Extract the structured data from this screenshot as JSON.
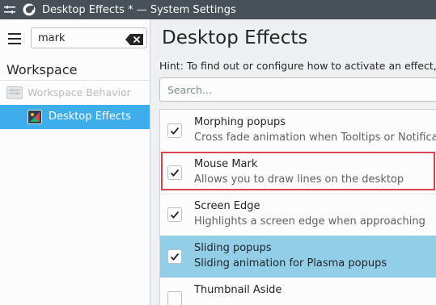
{
  "window": {
    "title": "Desktop Effects * — System Settings"
  },
  "sidebar": {
    "search_value": "mark",
    "category": "Workspace",
    "parent_item": "Workspace Behavior",
    "active_item": "Desktop Effects"
  },
  "main": {
    "title": "Desktop Effects",
    "hint": "Hint: To find out or configure how to activate an effect, lo",
    "search_placeholder": "Search...",
    "effects": [
      {
        "name": "Morphing popups",
        "description": "Cross fade animation when Tooltips or Notificatio",
        "checked": true,
        "selected": false,
        "highlighted": false
      },
      {
        "name": "Mouse Mark",
        "description": "Allows you to draw lines on the desktop",
        "checked": true,
        "selected": false,
        "highlighted": true
      },
      {
        "name": "Screen Edge",
        "description": "Highlights a screen edge when approaching",
        "checked": true,
        "selected": false,
        "highlighted": false
      },
      {
        "name": "Sliding popups",
        "description": "Sliding animation for Plasma popups",
        "checked": true,
        "selected": true,
        "highlighted": false
      },
      {
        "name": "Thumbnail Aside",
        "description": "",
        "checked": false,
        "selected": false,
        "highlighted": false
      }
    ]
  },
  "colors": {
    "accent": "#3daee9",
    "selection": "#93cee9",
    "highlight_border": "#da4453",
    "titlebar": "#475057"
  }
}
